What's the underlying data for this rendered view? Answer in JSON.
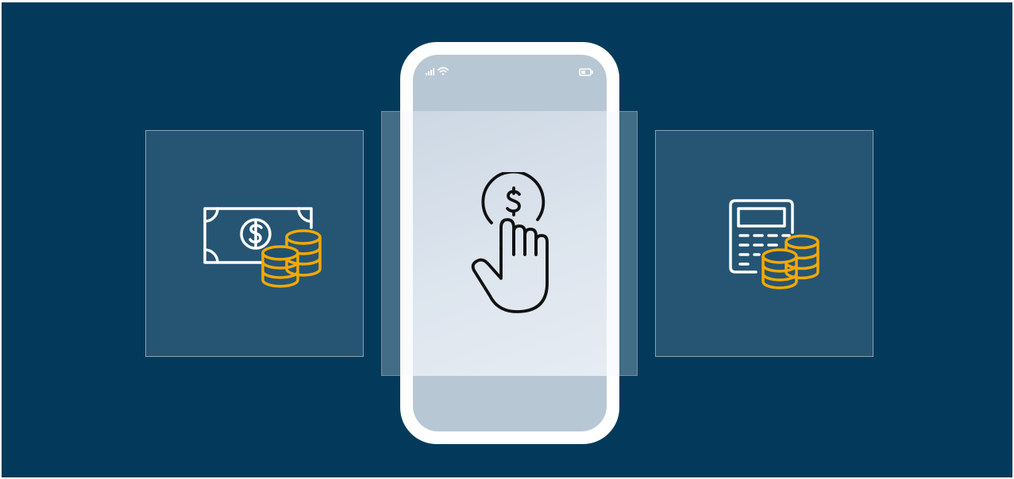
{
  "scene": {
    "type": "illustration",
    "colors": {
      "background": "#033a5c",
      "card_fill": "rgba(255,255,255,0.14)",
      "icon_white": "#ffffff",
      "icon_gold": "#f2a900",
      "icon_dark": "#111111",
      "phone_frame": "#ffffff",
      "phone_screen": "#b8c7d4"
    }
  },
  "left_card": {
    "icon": "banknote-with-coins-icon"
  },
  "right_card": {
    "icon": "calculator-with-coins-icon"
  },
  "phone": {
    "status_icons": [
      "signal-icon",
      "wifi-icon",
      "battery-icon"
    ],
    "center_icon": "hand-tap-dollar-coin-icon"
  }
}
